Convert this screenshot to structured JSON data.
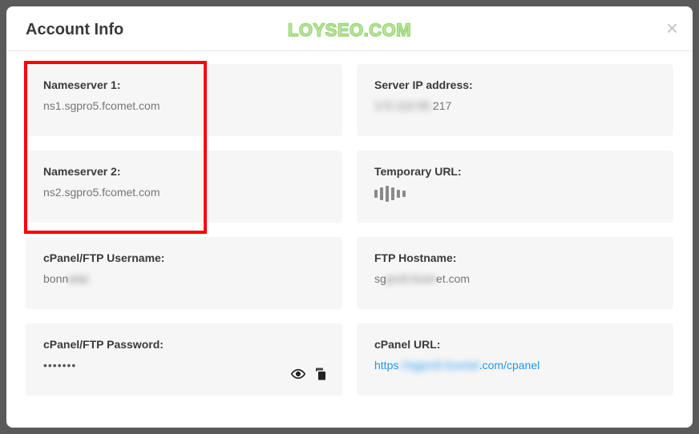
{
  "modal": {
    "title": "Account Info",
    "watermark": "LOYSEO.COM"
  },
  "cards": {
    "ns1": {
      "label": "Nameserver 1:",
      "value": "ns1.sgpro5.fcomet.com"
    },
    "ns2": {
      "label": "Nameserver 2:",
      "value": "ns2.sgpro5.fcomet.com"
    },
    "serverip": {
      "label": "Server IP address:",
      "value_prefix": "172.110.55.",
      "value_suffix": "217"
    },
    "tempurl": {
      "label": "Temporary URL:"
    },
    "cpanel_user": {
      "label": "cPanel/FTP Username:",
      "value_prefix": "bonn",
      "value_blur": "ielai"
    },
    "ftp_host": {
      "label": "FTP Hostname:",
      "value_prefix": "sg",
      "value_blur": "pro5.fcom",
      "value_suffix": "et.com"
    },
    "cpanel_pass": {
      "label": "cPanel/FTP Password:"
    },
    "cpanel_url": {
      "label": "cPanel URL:",
      "value_prefix": "https",
      "value_blur": "://sgpro5.fcomet",
      "value_suffix": ".com/cpanel"
    }
  }
}
